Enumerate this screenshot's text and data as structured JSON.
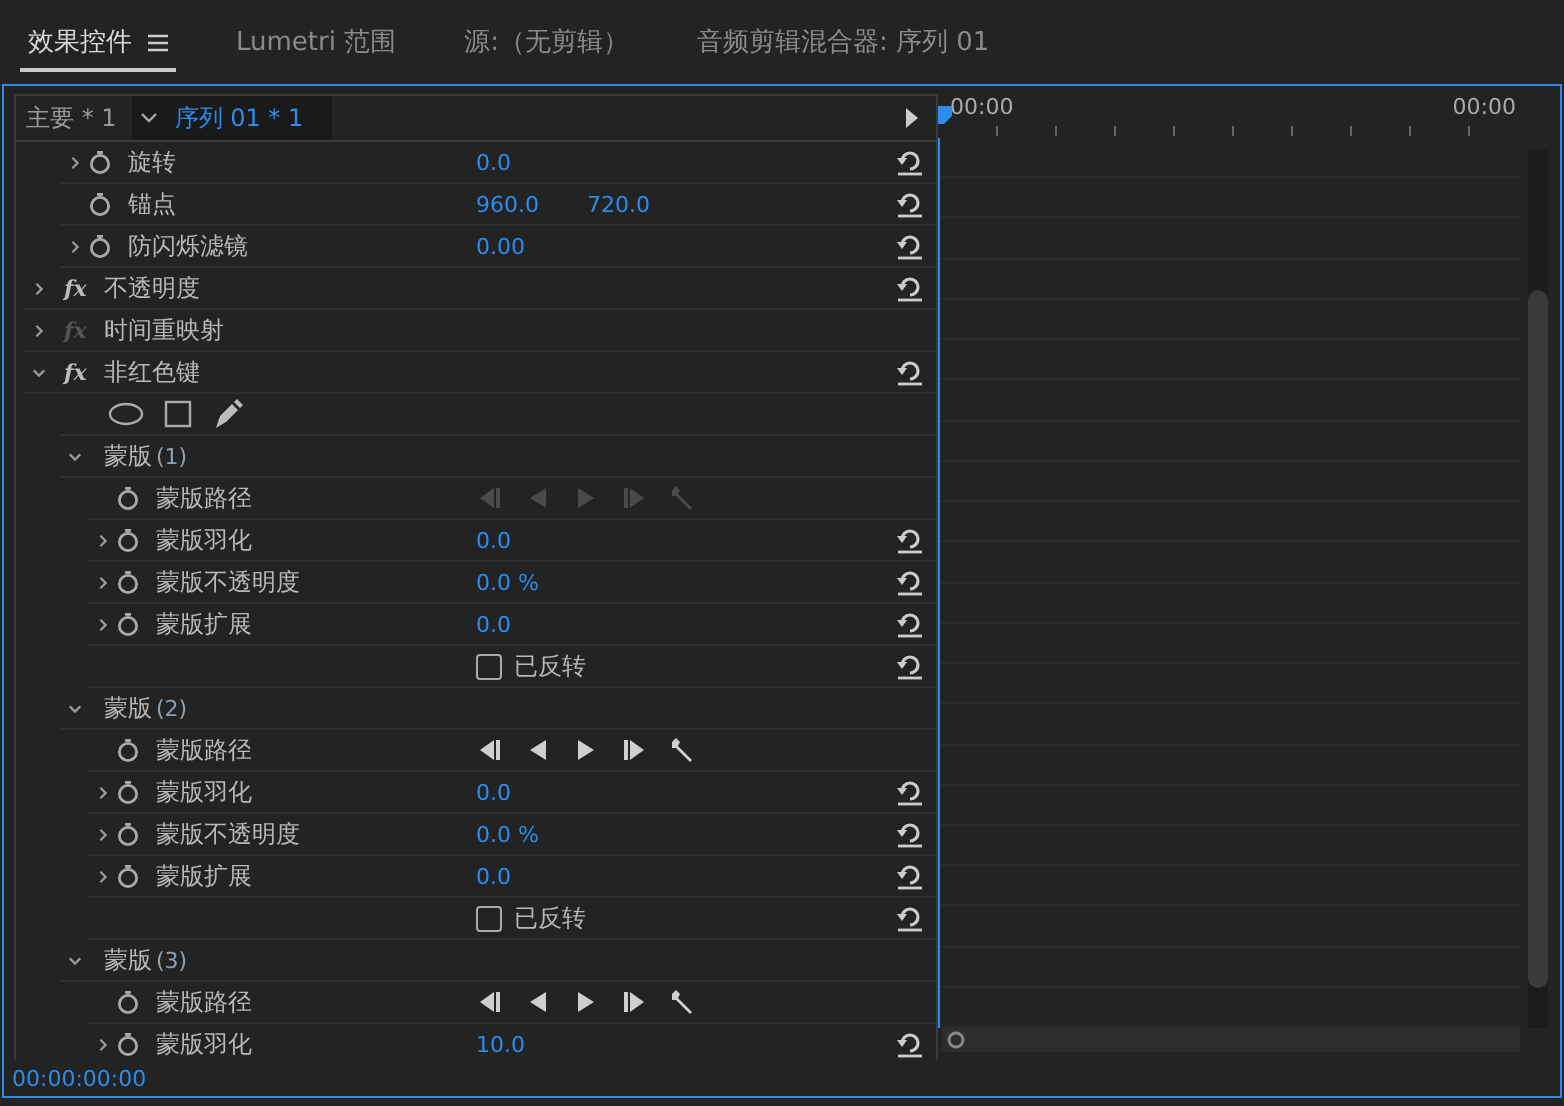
{
  "tabs": [
    {
      "label": "效果控件",
      "selected": true,
      "menu": true
    },
    {
      "label": "Lumetri 范围",
      "selected": false,
      "menu": false
    },
    {
      "label": "源:（无剪辑）",
      "selected": false,
      "menu": false
    },
    {
      "label": "音频剪辑混合器: 序列 01",
      "selected": false,
      "menu": false
    }
  ],
  "header": {
    "master": "主要 * 1",
    "sequence": "序列 01 * 1"
  },
  "properties": [
    {
      "kind": "property",
      "label": "旋转",
      "expandable": true,
      "values": [
        "0.0"
      ],
      "reset": true
    },
    {
      "kind": "property",
      "label": "锚点",
      "expandable": false,
      "values": [
        "960.0",
        "720.0"
      ],
      "reset": true
    },
    {
      "kind": "property",
      "label": "防闪烁滤镜",
      "expandable": true,
      "values": [
        "0.00"
      ],
      "reset": true
    }
  ],
  "effects": [
    {
      "label": "不透明度",
      "icon": "fx",
      "fx_enabled": true,
      "expanded": false,
      "reset": true
    },
    {
      "label": "时间重映射",
      "icon": "fx",
      "fx_enabled": false,
      "expanded": false,
      "reset": false
    },
    {
      "label": "非红色键",
      "icon": "fx",
      "fx_enabled": true,
      "expanded": true,
      "reset": true,
      "children": [
        {
          "kind": "tools"
        },
        {
          "kind": "mask",
          "label": "蒙版",
          "number": "(1)",
          "expanded": true,
          "children": [
            {
              "kind": "path",
              "label": "蒙版路径",
              "disabled": true
            },
            {
              "kind": "property",
              "label": "蒙版羽化",
              "expandable": true,
              "values": [
                "0.0"
              ],
              "reset": true
            },
            {
              "kind": "property",
              "label": "蒙版不透明度",
              "expandable": true,
              "values": [
                "0.0 %"
              ],
              "reset": true
            },
            {
              "kind": "property",
              "label": "蒙版扩展",
              "expandable": true,
              "values": [
                "0.0"
              ],
              "reset": true
            },
            {
              "kind": "checkbox",
              "label": "已反转",
              "checked": false,
              "reset": true
            }
          ]
        },
        {
          "kind": "mask",
          "label": "蒙版",
          "number": "(2)",
          "expanded": true,
          "children": [
            {
              "kind": "path",
              "label": "蒙版路径",
              "disabled": false
            },
            {
              "kind": "property",
              "label": "蒙版羽化",
              "expandable": true,
              "values": [
                "0.0"
              ],
              "reset": true
            },
            {
              "kind": "property",
              "label": "蒙版不透明度",
              "expandable": true,
              "values": [
                "0.0 %"
              ],
              "reset": true
            },
            {
              "kind": "property",
              "label": "蒙版扩展",
              "expandable": true,
              "values": [
                "0.0"
              ],
              "reset": true
            },
            {
              "kind": "checkbox",
              "label": "已反转",
              "checked": false,
              "reset": true
            }
          ]
        },
        {
          "kind": "mask",
          "label": "蒙版",
          "number": "(3)",
          "expanded": true,
          "children": [
            {
              "kind": "path",
              "label": "蒙版路径",
              "disabled": false
            },
            {
              "kind": "property",
              "label": "蒙版羽化",
              "expandable": true,
              "values": [
                "10.0"
              ],
              "reset": true
            }
          ]
        }
      ]
    }
  ],
  "ruler": {
    "start": "00:00",
    "end": "00:00"
  },
  "timecode": "00:00:00:00"
}
